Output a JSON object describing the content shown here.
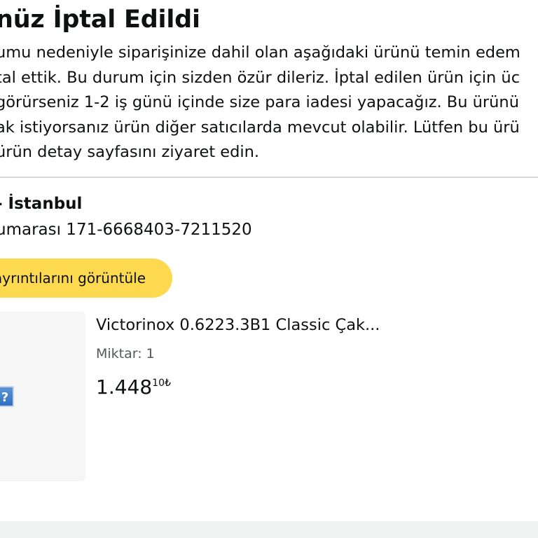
{
  "notice": {
    "title": "nüz İptal Edildi",
    "message_lines": [
      "umu nedeniyle siparişinize dahil olan aşağıdaki ürünü temin edem",
      "tal ettik. Bu durum için sizden özür dileriz. İptal edilen ürün için üc",
      " görürseniz 1-2 iş günü içinde size para iadesi yapacağız. Bu ürünü",
      "ak istiyorsanız ürün diğer satıcılarda mevcut olabilir. Lütfen bu ürü",
      " ürün detay sayfasını ziyaret edin."
    ]
  },
  "order": {
    "seller": "- İstanbul",
    "order_number": "umarası 171-6668403-7211520",
    "details_button_label": "ayrıntılarını görüntüle"
  },
  "item": {
    "title": "Victorinox 0.6223.3B1 Classic Çak...",
    "quantity": "Miktar: 1",
    "price_whole": "1.448",
    "price_fraction": "10",
    "price_currency": "₺",
    "image_placeholder_icon": "missing-image-icon",
    "image_placeholder_glyph": "?"
  },
  "colors": {
    "button_bg": "#fcd94e",
    "divider": "#d5d9d9",
    "image_bg": "#f6f6f6",
    "secondary_text": "#565959"
  }
}
